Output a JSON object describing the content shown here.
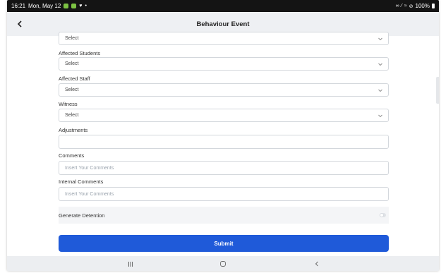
{
  "status_bar": {
    "time": "16:21",
    "date": "Mon, May 12",
    "battery": "100%"
  },
  "header": {
    "title": "Behaviour Event"
  },
  "form": {
    "top_select": "Select",
    "affected_students": {
      "label": "Affected Students",
      "value": "Select"
    },
    "affected_staff": {
      "label": "Affected Staff",
      "value": "Select"
    },
    "witness": {
      "label": "Witness",
      "value": "Select"
    },
    "adjustments": {
      "label": "Adjustments",
      "value": ""
    },
    "comments": {
      "label": "Comments",
      "placeholder": "Insert Your Comments"
    },
    "internal_comments": {
      "label": "Internal Comments",
      "placeholder": "Insert Your Comments"
    },
    "generate_detention": {
      "label": "Generate Detention",
      "enabled": false
    },
    "submit_label": "Submit"
  },
  "icons": {
    "back": "chevron-left-icon",
    "dropdown": "chevron-down-icon",
    "nav_recents": "recents-icon",
    "nav_home": "home-icon",
    "nav_back": "nav-back-icon"
  },
  "colors": {
    "accent": "#1f5ad9",
    "status_bar": "#141414"
  }
}
